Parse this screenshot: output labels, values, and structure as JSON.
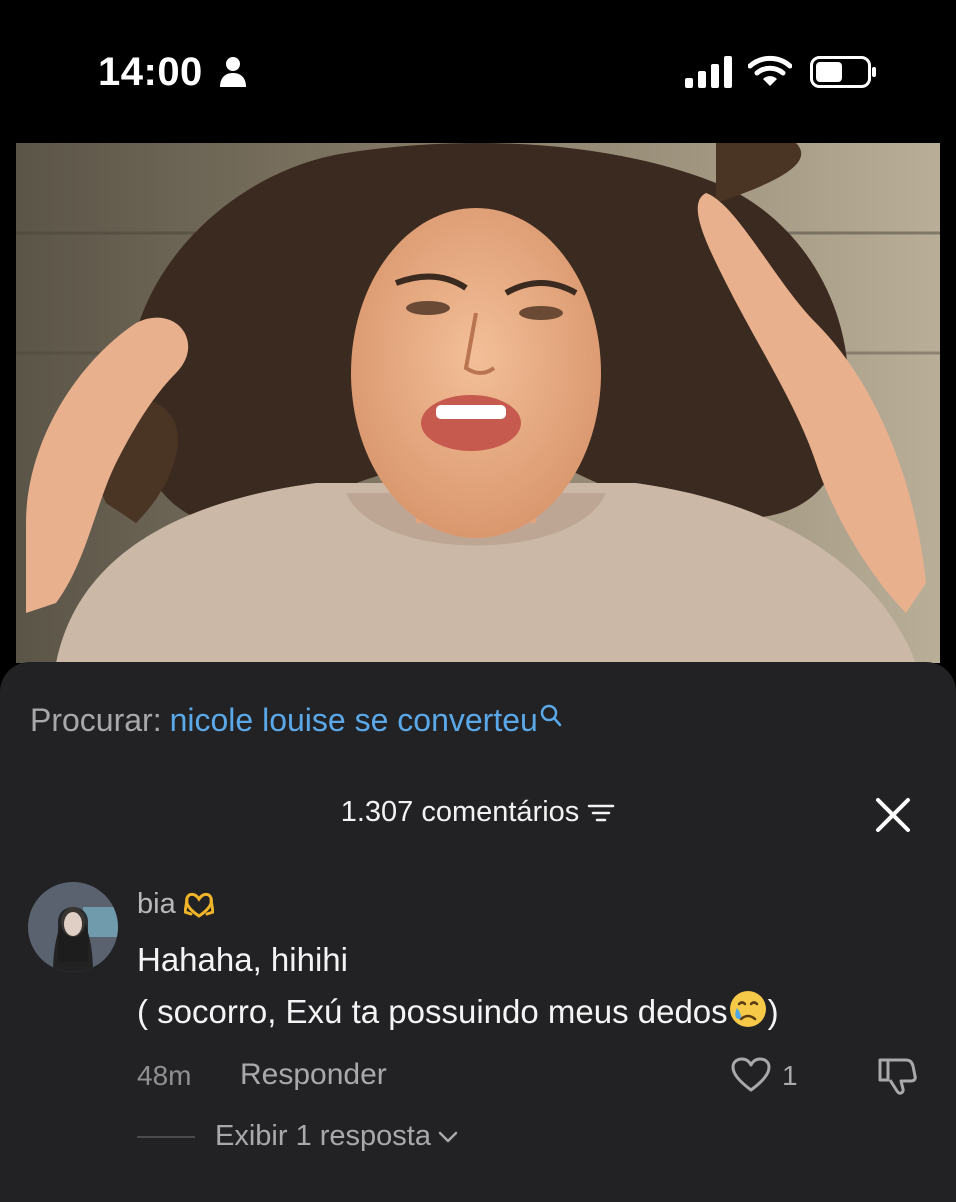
{
  "status_bar": {
    "time": "14:00",
    "icons": [
      "person-icon",
      "signal-icon",
      "wifi-icon",
      "battery-icon"
    ]
  },
  "video": {
    "icons": [
      "video-frame"
    ]
  },
  "search": {
    "label": "Procurar:",
    "query": "nicole louise se converteu",
    "icon": "search-icon"
  },
  "comments": {
    "header": "1.307 comentários",
    "sort_icon": "sort-icon",
    "close_icon": "close-icon",
    "items": [
      {
        "username": "bia",
        "username_icon": "heart-hands-icon",
        "text_line1": "Hahaha, hihihi",
        "text_line2": "( socorro, Exú ta possuindo meus dedos",
        "text_line2_end": ")",
        "emoji": "crying-face-icon",
        "timestamp": "48m",
        "reply_label": "Responder",
        "like_count": "1",
        "view_replies": "Exibir 1 resposta"
      }
    ]
  },
  "colors": {
    "sheet_background": "#222224",
    "link": "#5aa8e8",
    "muted_text": "#a9a9ad"
  }
}
